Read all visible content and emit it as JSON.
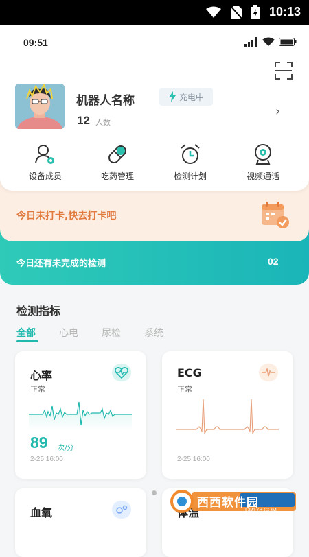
{
  "system_bar": {
    "time": "10:13"
  },
  "app_status": {
    "time": "09:51"
  },
  "robot": {
    "name": "机器人名称",
    "charge_status": "充电中",
    "count": "12",
    "count_unit": "人数"
  },
  "menu": [
    {
      "label": "设备成员",
      "icon": "device-members-icon"
    },
    {
      "label": "吃药管理",
      "icon": "medicine-pill-icon"
    },
    {
      "label": "检测计划",
      "icon": "alarm-clock-icon"
    },
    {
      "label": "视频通话",
      "icon": "webcam-icon"
    }
  ],
  "checkin": {
    "text": "今日未打卡,快去打卡吧"
  },
  "pending": {
    "text": "今日还有未完成的检测",
    "count": "02"
  },
  "metrics": {
    "title": "检测指标",
    "tabs": [
      "全部",
      "心电",
      "尿检",
      "系统"
    ],
    "active_tab": 0,
    "cards": [
      {
        "name": "心率",
        "status": "正常",
        "value": "89",
        "unit": "次/分",
        "time": "2-25  16:00"
      },
      {
        "name": "ECG",
        "status": "正常",
        "time": "2-25  16:00"
      },
      {
        "name": "血氧"
      },
      {
        "name": "体温"
      }
    ]
  },
  "watermark": {
    "text": "西西软件园",
    "sub": "CR173.COM"
  },
  "colors": {
    "teal": "#21b9ae",
    "orange": "#e07a3f",
    "light_orange": "#fdeee4"
  }
}
